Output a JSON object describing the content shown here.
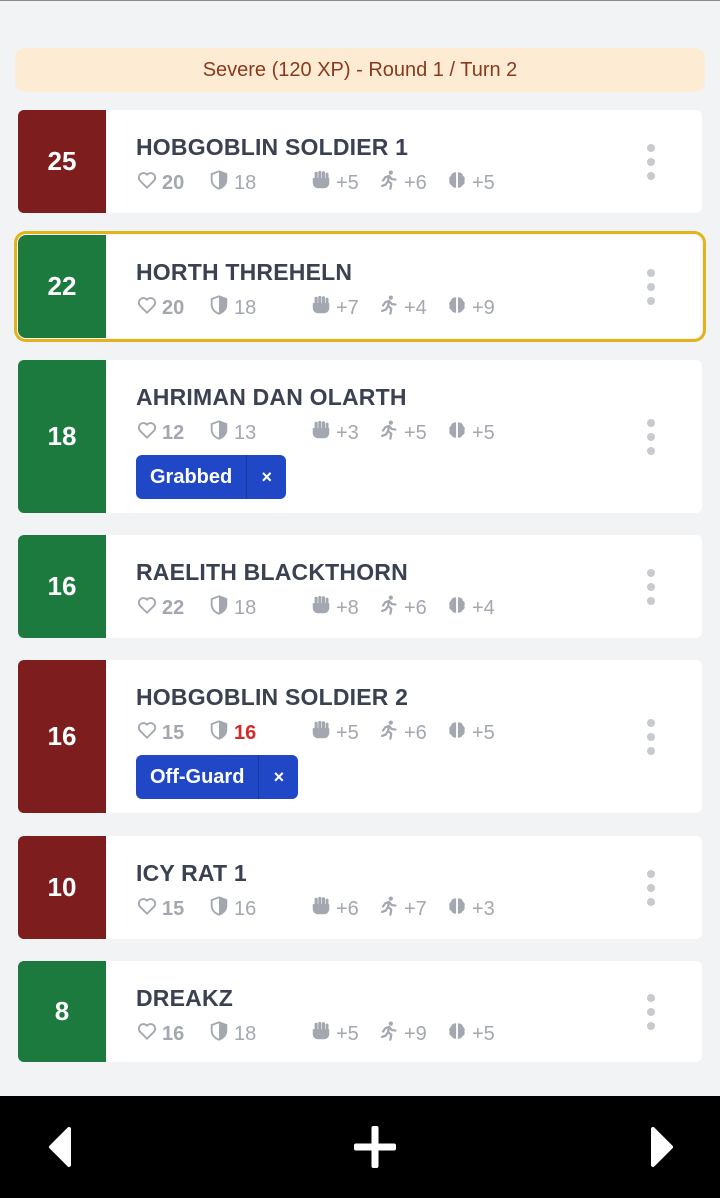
{
  "encounter": {
    "banner": "Severe (120 XP) - Round 1 / Turn 2"
  },
  "combatants": [
    {
      "initiative": "25",
      "side": "enemy",
      "name": "HOBGOBLIN SOLDIER 1",
      "hp": "20",
      "ac": "18",
      "ac_highlight": false,
      "fort": "+5",
      "reflex": "+6",
      "will": "+5",
      "conditions": [],
      "active": false
    },
    {
      "initiative": "22",
      "side": "ally",
      "name": "HORTH THREHELN",
      "hp": "20",
      "ac": "18",
      "ac_highlight": false,
      "fort": "+7",
      "reflex": "+4",
      "will": "+9",
      "conditions": [],
      "active": true
    },
    {
      "initiative": "18",
      "side": "ally",
      "name": "AHRIMAN DAN OLARTH",
      "hp": "12",
      "ac": "13",
      "ac_highlight": false,
      "fort": "+3",
      "reflex": "+5",
      "will": "+5",
      "conditions": [
        "Grabbed"
      ],
      "active": false
    },
    {
      "initiative": "16",
      "side": "ally",
      "name": "RAELITH BLACKTHORN",
      "hp": "22",
      "ac": "18",
      "ac_highlight": false,
      "fort": "+8",
      "reflex": "+6",
      "will": "+4",
      "conditions": [],
      "active": false
    },
    {
      "initiative": "16",
      "side": "enemy",
      "name": "HOBGOBLIN SOLDIER 2",
      "hp": "15",
      "ac": "16",
      "ac_highlight": true,
      "fort": "+5",
      "reflex": "+6",
      "will": "+5",
      "conditions": [
        "Off-Guard"
      ],
      "active": false
    },
    {
      "initiative": "10",
      "side": "enemy",
      "name": "ICY RAT 1",
      "hp": "15",
      "ac": "16",
      "ac_highlight": false,
      "fort": "+6",
      "reflex": "+7",
      "will": "+3",
      "conditions": [],
      "active": false
    },
    {
      "initiative": "8",
      "side": "ally",
      "name": "DREAKZ",
      "hp": "16",
      "ac": "18",
      "ac_highlight": false,
      "fort": "+5",
      "reflex": "+9",
      "will": "+5",
      "conditions": [],
      "active": false
    }
  ],
  "condition_remove_label": "×",
  "icons": {
    "hp": "heart-icon",
    "ac": "shield-icon",
    "fort": "fist-icon",
    "reflex": "running-icon",
    "will": "brain-icon",
    "menu": "kebab-menu-icon"
  },
  "nav": {
    "prev": "previous-turn-icon",
    "add": "add-icon",
    "next": "next-turn-icon"
  },
  "colors": {
    "enemy": "#7d1d1d",
    "ally": "#1c7a3f",
    "active_outline": "#e3b31b",
    "condition": "#1f47c6",
    "highlight_stat": "#d22a2a"
  }
}
